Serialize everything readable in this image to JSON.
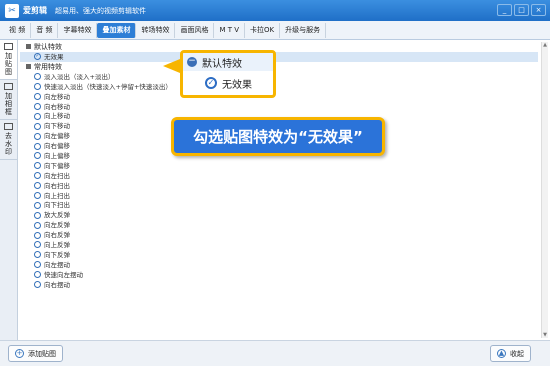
{
  "title": {
    "app_name": "爱剪辑",
    "subtitle": "超易用、强大的视频剪辑软件",
    "logo_glyph": "✂"
  },
  "window_controls": [
    "_",
    "□",
    "×"
  ],
  "menu": [
    "视 频",
    "音 频",
    "字幕特效",
    "叠加素材",
    "转场特效",
    "画面风格",
    "M T V",
    "卡拉OK",
    "升级与服务"
  ],
  "menu_active_index": 3,
  "left_tabs": [
    "加贴图",
    "加相框",
    "去水印"
  ],
  "groups": {
    "default": "默认特效",
    "common": "常用特效"
  },
  "default_items": [
    "无效果"
  ],
  "common_items": [
    "淡入淡出（淡入+淡出）",
    "快速淡入淡出（快速淡入+停留+快速淡出）",
    "向左移动",
    "向右移动",
    "向上移动",
    "向下移动",
    "向左偏移",
    "向右偏移",
    "向上偏移",
    "向下偏移",
    "向左扫出",
    "向右扫出",
    "向上扫出",
    "向下扫出",
    "放大反弹",
    "向左反弹",
    "向右反弹",
    "向上反弹",
    "向下反弹",
    "向左摆动",
    "快速向左摆动",
    "向右摆动"
  ],
  "popup": {
    "heading": "默认特效",
    "item": "无效果",
    "check": "✓",
    "minus": "−"
  },
  "callout": "勾选贴图特效为“无效果”",
  "buttons": {
    "add_sticker": "添加贴图",
    "collapse": "收起",
    "add_glyph": "+",
    "collapse_glyph": "▲"
  },
  "colors": {
    "accent": "#2d7ed6",
    "highlight": "#f7b500"
  }
}
